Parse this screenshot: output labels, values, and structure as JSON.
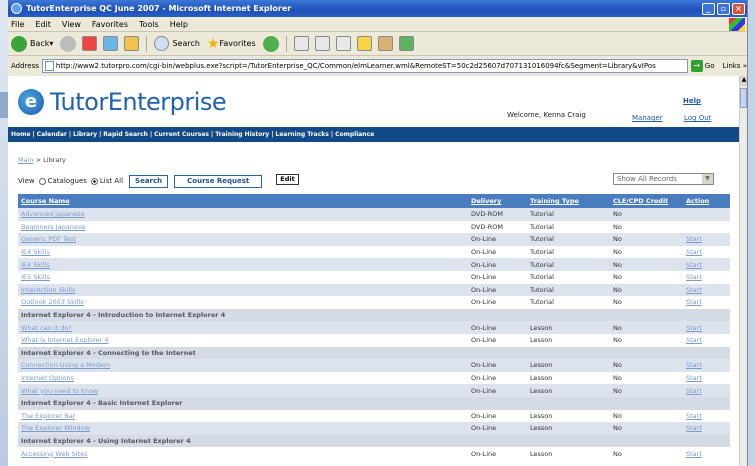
{
  "window": {
    "title": "TutorEnterprise QC June 2007 - Microsoft Internet Explorer"
  },
  "menu": [
    "File",
    "Edit",
    "View",
    "Favorites",
    "Tools",
    "Help"
  ],
  "toolbar": {
    "back": "Back",
    "search": "Search",
    "favorites": "Favorites"
  },
  "address": {
    "label": "Address",
    "url": "http://www2.tutorpro.com/cgi-bin/webplus.exe?script=/TutorEnterprise_QC/Common/elmLearner.wml&RemoteST=50c2d25607d7071310160​94fc&Segment=Library&vIPos",
    "go": "Go",
    "links": "Links »"
  },
  "header": {
    "logo_text": "TutorEnterprise",
    "help": "Help",
    "welcome": "Welcome, Kenna Craig",
    "manager": "Manager",
    "logout": "Log Out"
  },
  "nav": [
    "Home",
    "Calendar",
    "Library",
    "Rapid Search",
    "Current Courses",
    "Training History",
    "Learning Tracks",
    "Compliance"
  ],
  "breadcrumb": {
    "main": "Main",
    "sep": ">",
    "current": "Library"
  },
  "view": {
    "label": "View",
    "opt1": "Catalogues",
    "opt2": "List All",
    "search": "Search",
    "course_request": "Course Request",
    "edit": "Edit",
    "filter": "Show All Records"
  },
  "table": {
    "headers": [
      "Course Name",
      "Delivery",
      "Training Type",
      "CLE/CPD Credit",
      "Action"
    ],
    "rows": [
      {
        "name": "Advanced Japanese",
        "delivery": "DVD-ROM",
        "type": "Tutorial",
        "credit": "No",
        "action": ""
      },
      {
        "name": "Beginners Japanese",
        "delivery": "DVD-ROM",
        "type": "Tutorial",
        "credit": "No",
        "action": ""
      },
      {
        "name": "Generic PDF Test",
        "delivery": "On-Line",
        "type": "Tutorial",
        "credit": "No",
        "action": "Start"
      },
      {
        "name": "IE4 Skills",
        "delivery": "On-Line",
        "type": "Tutorial",
        "credit": "No",
        "action": "Start"
      },
      {
        "name": "IE4 Skills",
        "delivery": "On-Line",
        "type": "Tutorial",
        "credit": "No",
        "action": "Start"
      },
      {
        "name": "IE5 Skills",
        "delivery": "On-Line",
        "type": "Tutorial",
        "credit": "No",
        "action": "Start"
      },
      {
        "name": "InterAction Skills",
        "delivery": "On-Line",
        "type": "Tutorial",
        "credit": "No",
        "action": "Start"
      },
      {
        "name": "Outlook 2003 Skills",
        "delivery": "On-Line",
        "type": "Tutorial",
        "credit": "No",
        "action": "Start"
      },
      {
        "group": "Internet Explorer 4 - Introduction to Internet Explorer 4"
      },
      {
        "name": "What can it do?",
        "delivery": "On-Line",
        "type": "Lesson",
        "credit": "No",
        "action": "Start"
      },
      {
        "name": "What is Internet Explorer 4",
        "delivery": "On-Line",
        "type": "Lesson",
        "credit": "No",
        "action": "Start"
      },
      {
        "group": "Internet Explorer 4 - Connecting to the Internet"
      },
      {
        "name": "Connection Using a Modem",
        "delivery": "On-Line",
        "type": "Lesson",
        "credit": "No",
        "action": "Start"
      },
      {
        "name": "Internet Options",
        "delivery": "On-Line",
        "type": "Lesson",
        "credit": "No",
        "action": "Start"
      },
      {
        "name": "What you need to know",
        "delivery": "On-Line",
        "type": "Lesson",
        "credit": "No",
        "action": "Start"
      },
      {
        "group": "Internet Explorer 4 - Basic Internet Explorer"
      },
      {
        "name": "The Explorer Bar",
        "delivery": "On-Line",
        "type": "Lesson",
        "credit": "No",
        "action": "Start"
      },
      {
        "name": "The Explorer Window",
        "delivery": "On-Line",
        "type": "Lesson",
        "credit": "No",
        "action": "Start"
      },
      {
        "group": "Internet Explorer 4 - Using Internet Explorer 4"
      },
      {
        "name": "Accessing Web Sites",
        "delivery": "On-Line",
        "type": "Lesson",
        "credit": "No",
        "action": "Start"
      }
    ]
  },
  "colors": {
    "brand": "#1e62b0",
    "nav_bg": "#124a88",
    "table_header": "#4a7cc0"
  }
}
